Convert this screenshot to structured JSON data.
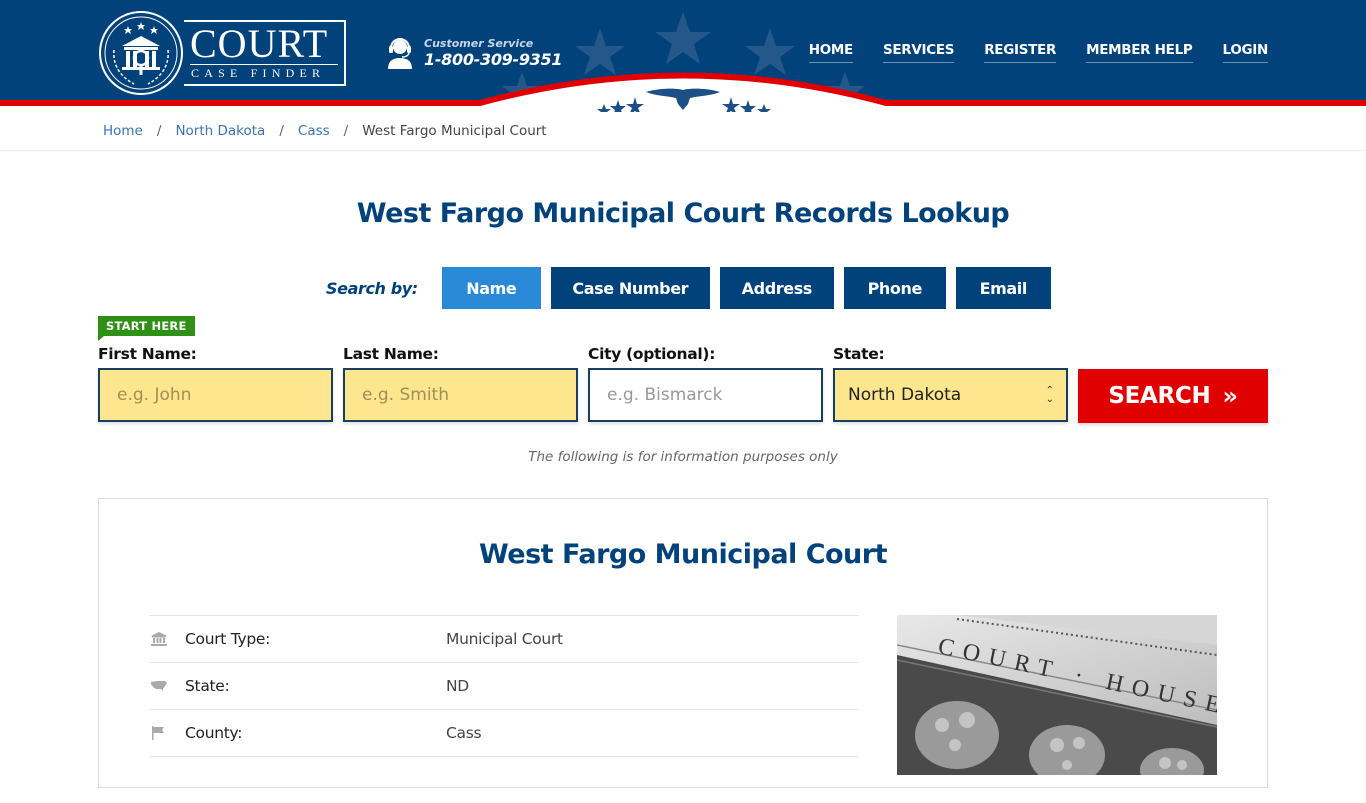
{
  "header": {
    "logo": {
      "title": "COURT",
      "subtitle": "CASE FINDER"
    },
    "customer_service": {
      "label": "Customer Service",
      "phone": "1-800-309-9351",
      "icon": "headset-agent-icon"
    },
    "nav": [
      {
        "label": "HOME"
      },
      {
        "label": "SERVICES"
      },
      {
        "label": "REGISTER"
      },
      {
        "label": "MEMBER HELP"
      },
      {
        "label": "LOGIN"
      }
    ],
    "colors": {
      "primary": "#02427a",
      "accent_red": "#e10000"
    }
  },
  "breadcrumb": {
    "items": [
      {
        "label": "Home"
      },
      {
        "label": "North Dakota"
      },
      {
        "label": "Cass"
      }
    ],
    "current": "West Fargo Municipal Court",
    "separator": "/"
  },
  "search": {
    "title": "West Fargo Municipal Court Records Lookup",
    "search_by_label": "Search by:",
    "tabs": [
      {
        "label": "Name",
        "active": true
      },
      {
        "label": "Case Number",
        "active": false
      },
      {
        "label": "Address",
        "active": false
      },
      {
        "label": "Phone",
        "active": false
      },
      {
        "label": "Email",
        "active": false
      }
    ],
    "start_here": "START HERE",
    "fields": {
      "first_name": {
        "label": "First Name:",
        "placeholder": "e.g. John",
        "value": ""
      },
      "last_name": {
        "label": "Last Name:",
        "placeholder": "e.g. Smith",
        "value": ""
      },
      "city": {
        "label": "City (optional):",
        "placeholder": "e.g.  Bismarck",
        "value": ""
      },
      "state": {
        "label": "State:",
        "value": "North Dakota"
      }
    },
    "search_button": "SEARCH",
    "note": "The following is for information purposes only"
  },
  "court": {
    "name": "West Fargo Municipal Court",
    "details": [
      {
        "icon": "courthouse-icon",
        "label": "Court Type:",
        "value": "Municipal Court"
      },
      {
        "icon": "us-map-icon",
        "label": "State:",
        "value": "ND"
      },
      {
        "icon": "flag-icon",
        "label": "County:",
        "value": "Cass"
      }
    ],
    "photo_caption": "COURT · HOUSE"
  }
}
